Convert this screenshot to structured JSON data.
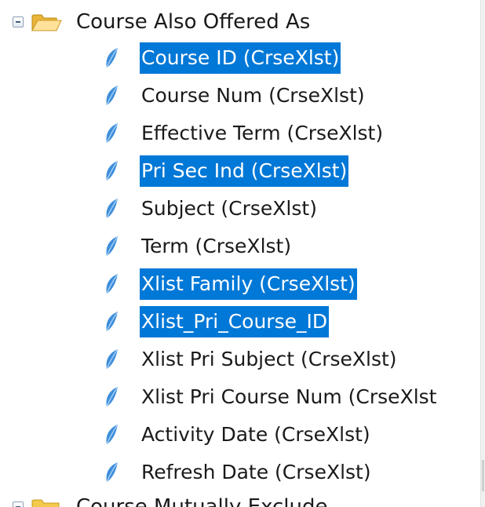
{
  "tree": {
    "folder": {
      "label": "Course Also Offered As",
      "expanded": true,
      "icon": "open-folder-icon"
    },
    "fields": [
      {
        "label": "Course ID (CrseXlst)",
        "selected": true
      },
      {
        "label": "Course Num (CrseXlst)",
        "selected": false
      },
      {
        "label": "Effective Term (CrseXlst)",
        "selected": false
      },
      {
        "label": "Pri Sec Ind (CrseXlst)",
        "selected": true
      },
      {
        "label": "Subject (CrseXlst)",
        "selected": false
      },
      {
        "label": "Term (CrseXlst)",
        "selected": false
      },
      {
        "label": "Xlist Family (CrseXlst)",
        "selected": true
      },
      {
        "label": "Xlist_Pri_Course_ID",
        "selected": true
      },
      {
        "label": "Xlist Pri Subject (CrseXlst)",
        "selected": false
      },
      {
        "label": "Xlist Pri Course Num (CrseXlst",
        "selected": false
      },
      {
        "label": "Activity Date (CrseXlst)",
        "selected": false
      },
      {
        "label": "Refresh Date (CrseXlst)",
        "selected": false
      }
    ],
    "next_folder": {
      "label": "Course Mutually Exclude",
      "expanded": false,
      "icon": "closed-folder-icon"
    },
    "colors": {
      "selection": "#0078d7",
      "leaf": "#3d8edb",
      "folder": "#f2c94c"
    }
  }
}
